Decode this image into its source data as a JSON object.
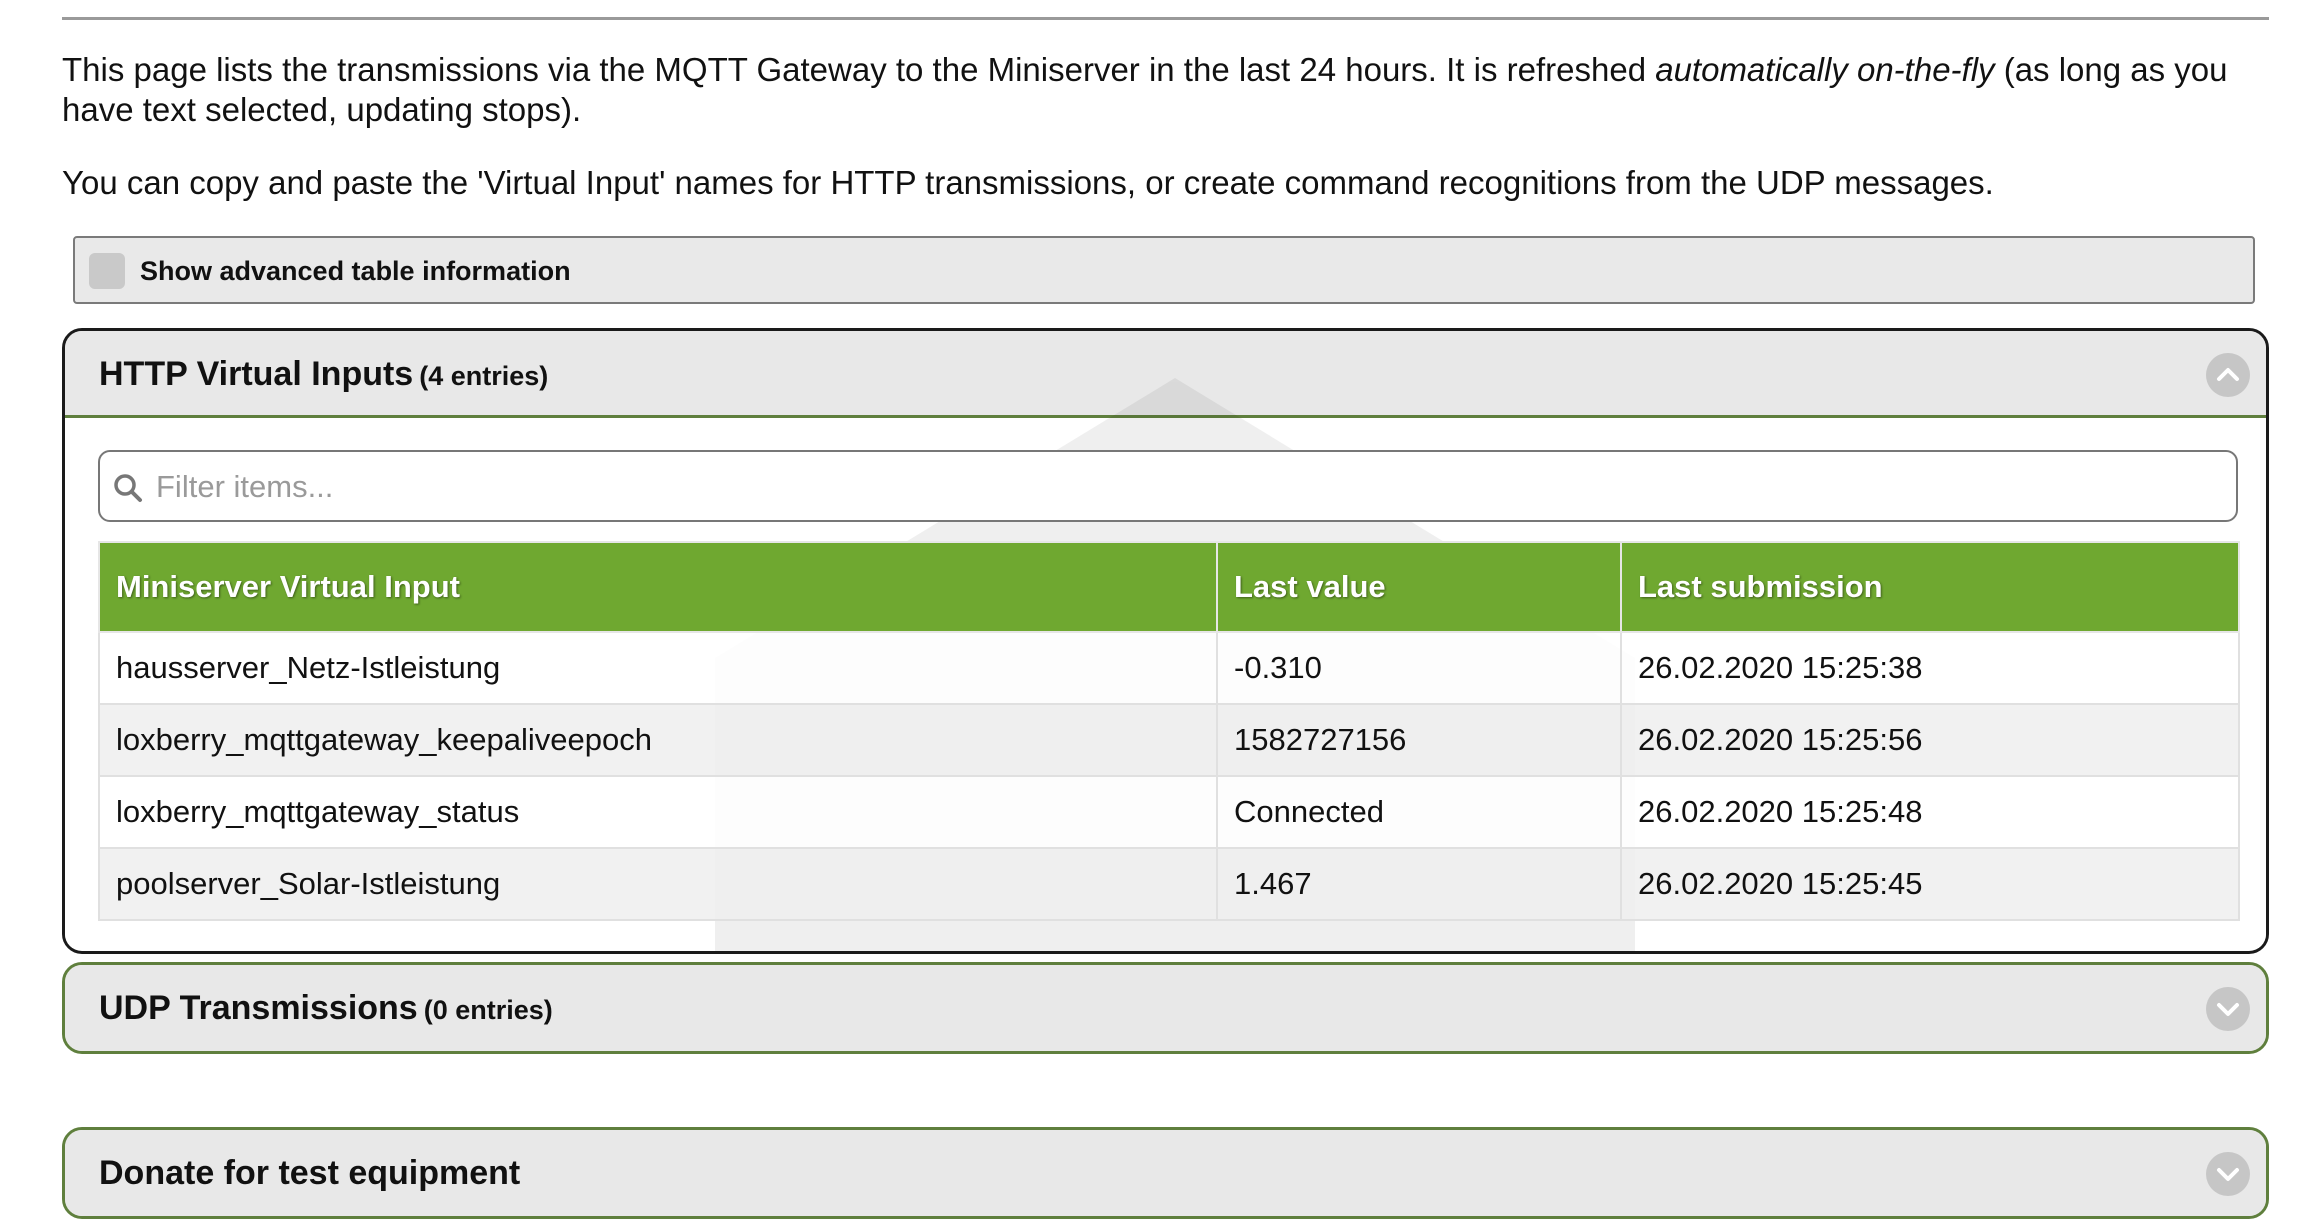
{
  "intro": {
    "text_before": "This page lists the transmissions via the MQTT Gateway to the Miniserver in the last 24 hours. It is refreshed ",
    "text_emphasis": "automatically on-the-fly",
    "text_after": " (as long as you have text selected, updating stops).",
    "copy_hint": "You can copy and paste the 'Virtual Input' names for HTTP transmissions, or create command recognitions from the UDP messages."
  },
  "advanced": {
    "label": "Show advanced table information",
    "checked": false
  },
  "http_panel": {
    "title": "HTTP Virtual Inputs",
    "count": "(4 entries)",
    "filter_placeholder": "Filter items...",
    "filter_value": "",
    "columns": [
      "Miniserver Virtual Input",
      "Last value",
      "Last submission"
    ],
    "rows": [
      {
        "input": "hausserver_Netz-Istleistung",
        "value": "-0.310",
        "submission": "26.02.2020 15:25:38"
      },
      {
        "input": "loxberry_mqttgateway_keepaliveepoch",
        "value": "1582727156",
        "submission": "26.02.2020 15:25:56"
      },
      {
        "input": "loxberry_mqttgateway_status",
        "value": "Connected",
        "submission": "26.02.2020 15:25:48"
      },
      {
        "input": "poolserver_Solar-Istleistung",
        "value": "1.467",
        "submission": "26.02.2020 15:25:45"
      }
    ]
  },
  "udp_panel": {
    "title": "UDP Transmissions",
    "count": "(0 entries)"
  },
  "donate_panel": {
    "title": "Donate for test equipment"
  },
  "colors": {
    "header_green": "#6fa830",
    "panel_border_green": "#5f7f3d",
    "panel_header_bg": "#e8e8e8"
  },
  "icons": {
    "collapse": "chevron-up-icon",
    "expand": "chevron-down-icon",
    "search": "search-icon"
  }
}
